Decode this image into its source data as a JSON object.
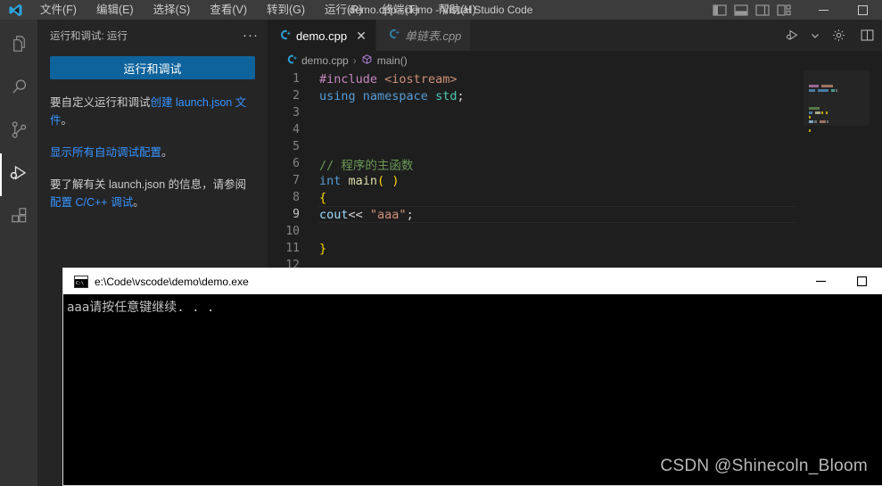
{
  "titlebar": {
    "logo_icon": "vscode-logo-icon",
    "window_title": "demo.cpp - demo - Visual Studio Code",
    "menu": [
      {
        "label": "文件(F)",
        "name": "menu-file"
      },
      {
        "label": "编辑(E)",
        "name": "menu-edit"
      },
      {
        "label": "选择(S)",
        "name": "menu-selection"
      },
      {
        "label": "查看(V)",
        "name": "menu-view"
      },
      {
        "label": "转到(G)",
        "name": "menu-go"
      },
      {
        "label": "运行(R)",
        "name": "menu-run"
      },
      {
        "label": "终端(T)",
        "name": "menu-terminal"
      },
      {
        "label": "帮助(H)",
        "name": "menu-help"
      }
    ],
    "layout_icons": [
      "toggle-primary-sidebar-icon",
      "toggle-panel-icon",
      "toggle-secondary-sidebar-icon",
      "customize-layout-icon"
    ],
    "minimize_label": "—",
    "maximize_label": "▢"
  },
  "activitybar": {
    "items": [
      {
        "name": "explorer",
        "icon": "files-icon",
        "active": false
      },
      {
        "name": "search",
        "icon": "search-icon",
        "active": false
      },
      {
        "name": "source-control",
        "icon": "source-control-icon",
        "active": false
      },
      {
        "name": "run-and-debug",
        "icon": "run-and-debug-icon",
        "active": true
      },
      {
        "name": "extensions",
        "icon": "extensions-icon",
        "active": false
      }
    ]
  },
  "sidebar": {
    "header_title": "运行和调试: 运行",
    "more_actions": "···",
    "run_button_label": "运行和调试",
    "accent_color": "#0e639c",
    "link_color": "#3794ff",
    "para1_pre": "要自定义运行和调试",
    "para1_link": "创建 launch.json 文件",
    "para1_post": "。",
    "para2_link": "显示所有自动调试配置",
    "para2_post": "。",
    "para3_pre": "要了解有关 launch.json 的信息，请参阅 ",
    "para3_link": "配置 C/C++ 调试",
    "para3_post": "。"
  },
  "editor": {
    "tabs": [
      {
        "label": "demo.cpp",
        "icon": "cpp-file-icon",
        "active": true,
        "preview": false,
        "close": "✕"
      },
      {
        "label": "单链表.cpp",
        "icon": "cpp-file-icon",
        "active": false,
        "preview": true,
        "close": ""
      }
    ],
    "actions": [
      {
        "name": "run-or-debug-button",
        "icon": "run-debug-icon"
      },
      {
        "name": "run-dropdown-chevron",
        "icon": "chevron-down-icon"
      },
      {
        "name": "open-settings-button",
        "icon": "gear-icon"
      },
      {
        "name": "split-editor-button",
        "icon": "split-editor-icon"
      }
    ],
    "breadcrumb": {
      "file": "demo.cpp",
      "separator": "›",
      "symbol": "main()",
      "file_icon": "cpp-file-icon",
      "symbol_icon": "method-cube-icon"
    },
    "code": [
      {
        "n": "1",
        "current": false,
        "tokens": [
          {
            "t": "#include",
            "c": "inc"
          },
          {
            "t": " ",
            "c": "pl"
          },
          {
            "t": "<iostream>",
            "c": "hdr"
          }
        ]
      },
      {
        "n": "2",
        "current": false,
        "tokens": [
          {
            "t": "using",
            "c": "kw"
          },
          {
            "t": " ",
            "c": "pl"
          },
          {
            "t": "namespace",
            "c": "kw"
          },
          {
            "t": " ",
            "c": "pl"
          },
          {
            "t": "std",
            "c": "typ"
          },
          {
            "t": ";",
            "c": "pl"
          }
        ]
      },
      {
        "n": "3",
        "current": false,
        "tokens": []
      },
      {
        "n": "4",
        "current": false,
        "tokens": []
      },
      {
        "n": "5",
        "current": false,
        "tokens": []
      },
      {
        "n": "6",
        "current": false,
        "tokens": [
          {
            "t": "// 程序的主函数",
            "c": "com"
          }
        ]
      },
      {
        "n": "7",
        "current": false,
        "tokens": [
          {
            "t": "int",
            "c": "kw"
          },
          {
            "t": " ",
            "c": "pl"
          },
          {
            "t": "main",
            "c": "fn"
          },
          {
            "t": "(",
            "c": "brkt-y"
          },
          {
            "t": " ",
            "c": "pl"
          },
          {
            "t": ")",
            "c": "brkt-y"
          }
        ]
      },
      {
        "n": "8",
        "current": false,
        "tokens": [
          {
            "t": "{",
            "c": "brkt-y"
          }
        ]
      },
      {
        "n": "9",
        "current": true,
        "tokens": [
          {
            "t": "cout",
            "c": "var"
          },
          {
            "t": "<<",
            "c": "pl"
          },
          {
            "t": " ",
            "c": "pl"
          },
          {
            "t": "\"aaa\"",
            "c": "str"
          },
          {
            "t": ";",
            "c": "pl"
          }
        ]
      },
      {
        "n": "10",
        "current": false,
        "tokens": []
      },
      {
        "n": "11",
        "current": false,
        "tokens": [
          {
            "t": "}",
            "c": "brkt-y"
          }
        ]
      },
      {
        "n": "12",
        "current": false,
        "tokens": []
      }
    ],
    "minimap_label": "minimap"
  },
  "console": {
    "title": "e:\\Code\\vscode\\demo\\demo.exe",
    "icon": "cmd-console-icon",
    "icon_text": "C:\\",
    "minimize_label": "—",
    "maximize_label": "▢",
    "output": "aaa请按任意键继续. . ."
  },
  "watermark": {
    "text": "CSDN @Shinecoln_Bloom"
  }
}
